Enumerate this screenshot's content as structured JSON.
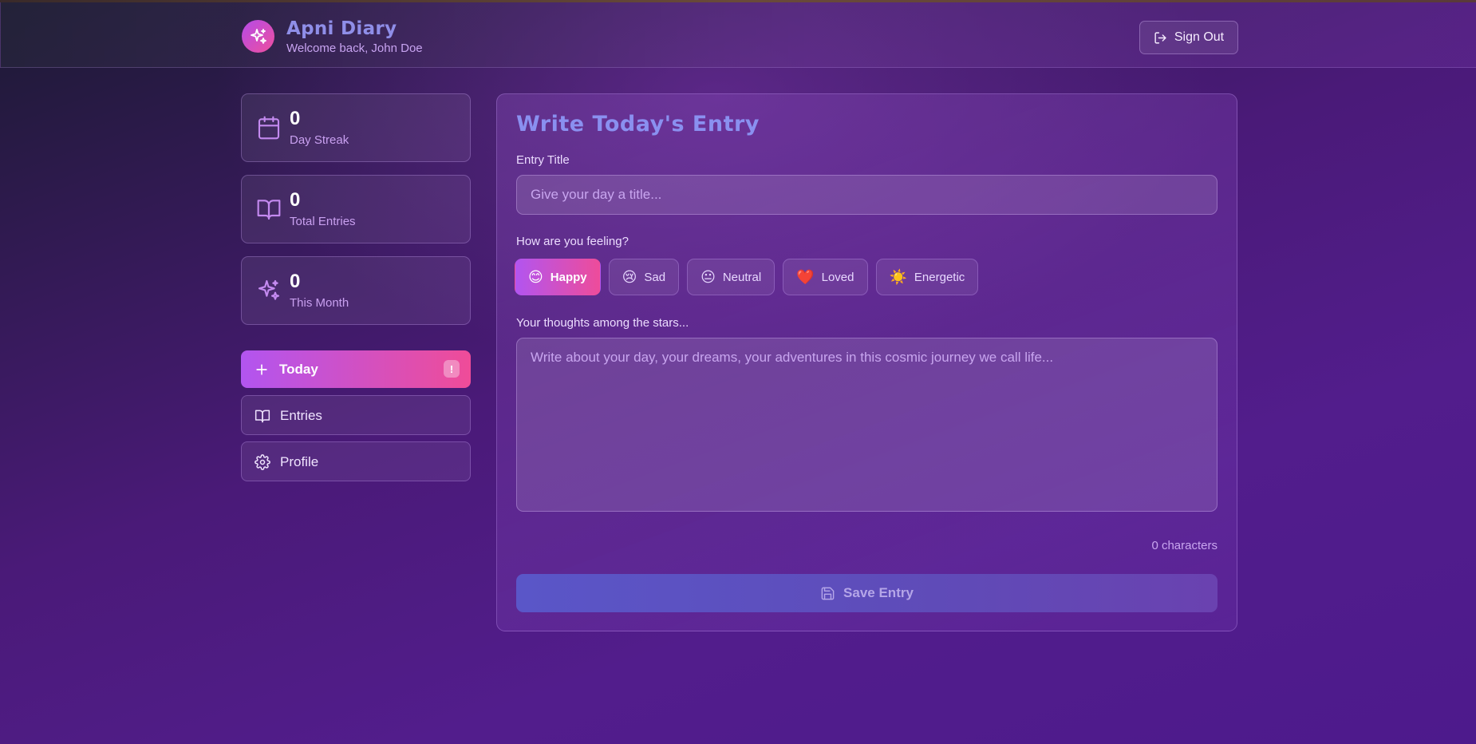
{
  "header": {
    "app_title": "Apni Diary",
    "subtitle": "Welcome back, John Doe",
    "signout_label": "Sign Out"
  },
  "stats": [
    {
      "value": "0",
      "label": "Day Streak",
      "icon": "calendar-icon"
    },
    {
      "value": "0",
      "label": "Total Entries",
      "icon": "book-icon"
    },
    {
      "value": "0",
      "label": "This Month",
      "icon": "sparkles-icon"
    }
  ],
  "nav": [
    {
      "label": "Today",
      "icon": "plus-icon",
      "active": true,
      "badge": "!"
    },
    {
      "label": "Entries",
      "icon": "book-icon",
      "active": false
    },
    {
      "label": "Profile",
      "icon": "gear-icon",
      "active": false
    }
  ],
  "entry": {
    "title": "Write Today's Entry",
    "title_label": "Entry Title",
    "title_placeholder": "Give your day a title...",
    "mood_label": "How are you feeling?",
    "moods": [
      {
        "emoji": "😊",
        "label": "Happy",
        "selected": true
      },
      {
        "emoji": "😢",
        "label": "Sad",
        "selected": false
      },
      {
        "emoji": "😐",
        "label": "Neutral",
        "selected": false
      },
      {
        "emoji": "❤️",
        "label": "Loved",
        "selected": false
      },
      {
        "emoji": "☀️",
        "label": "Energetic",
        "selected": false
      }
    ],
    "thoughts_label": "Your thoughts among the stars...",
    "thoughts_placeholder": "Write about your day, your dreams, your adventures in this cosmic journey we call life...",
    "char_count": "0 characters",
    "save_label": "Save Entry"
  },
  "colors": {
    "accent_start": "#b255f0",
    "accent_end": "#ef4c98",
    "title_blue": "#8a90f0"
  }
}
